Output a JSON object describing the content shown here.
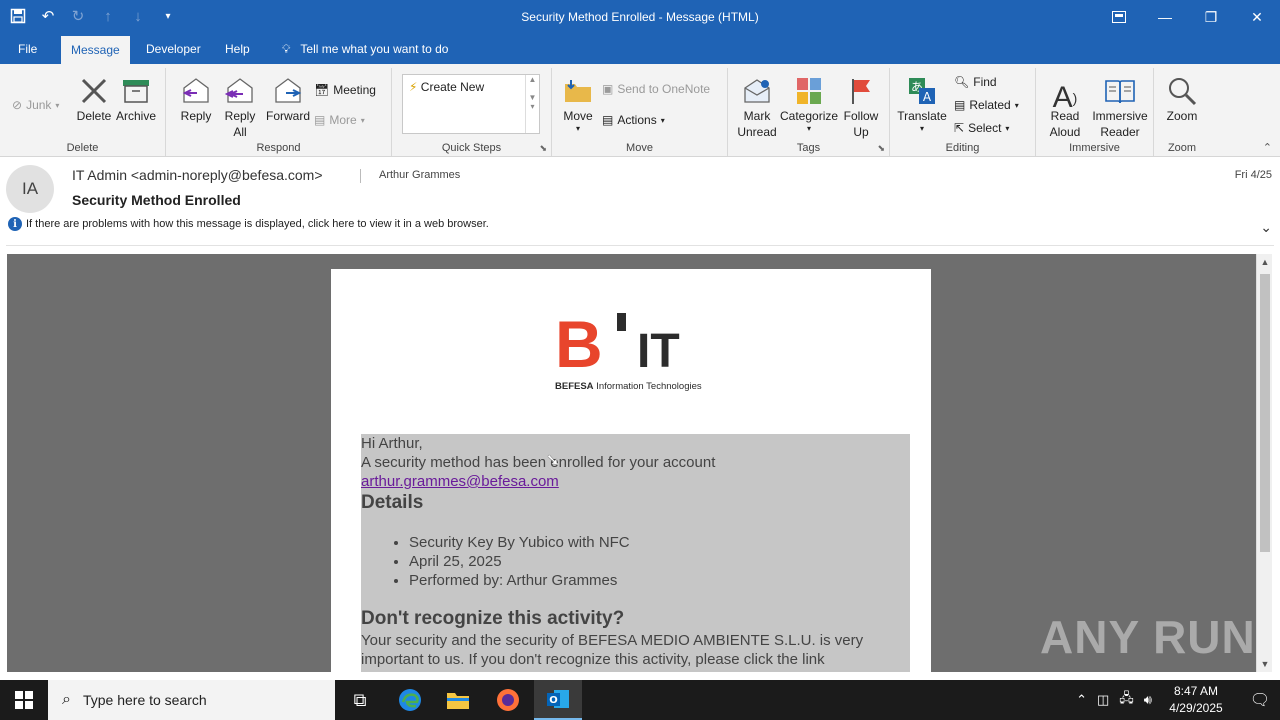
{
  "window": {
    "title": "Security Method Enrolled  -  Message (HTML)"
  },
  "menu": {
    "file": "File",
    "message": "Message",
    "developer": "Developer",
    "help": "Help",
    "tell_me": "Tell me what you want to do"
  },
  "ribbon": {
    "delete_group": {
      "label": "Delete",
      "junk": "Junk",
      "delete": "Delete",
      "archive": "Archive"
    },
    "respond_group": {
      "label": "Respond",
      "reply": "Reply",
      "reply_all_1": "Reply",
      "reply_all_2": "All",
      "forward": "Forward",
      "meeting": "Meeting",
      "more": "More"
    },
    "quicksteps_group": {
      "label": "Quick Steps",
      "create_new": "Create New"
    },
    "move_group": {
      "label": "Move",
      "move": "Move",
      "send_onenote": "Send to OneNote",
      "actions": "Actions"
    },
    "tags_group": {
      "label": "Tags",
      "mark_unread_1": "Mark",
      "mark_unread_2": "Unread",
      "categorize": "Categorize",
      "follow_up_1": "Follow",
      "follow_up_2": "Up"
    },
    "editing_group": {
      "label": "Editing",
      "translate": "Translate",
      "find": "Find",
      "related": "Related",
      "select": "Select"
    },
    "immersive_group": {
      "label": "Immersive",
      "read_aloud_1": "Read",
      "read_aloud_2": "Aloud",
      "immersive_reader_1": "Immersive",
      "immersive_reader_2": "Reader"
    },
    "zoom_group": {
      "label": "Zoom",
      "zoom": "Zoom"
    }
  },
  "message_header": {
    "avatar_initials": "IA",
    "sender": "IT Admin <admin-noreply@befesa.com>",
    "recipient": "Arthur Grammes",
    "date": "Fri 4/25",
    "subject": "Security Method Enrolled",
    "info_bar": "If there are problems with how this message is displayed, click here to view it in a web browser."
  },
  "email_body": {
    "logo_b": "B",
    "logo_it": "IT",
    "logo_company": "BEFESA",
    "logo_tagline": " Information Technologies",
    "greeting": "Hi Arthur,",
    "intro": "A security method has been enrolled for your account",
    "account_link": "arthur.grammes@befesa.com",
    "details_heading": "Details",
    "details": [
      "Security Key By Yubico with NFC",
      "April 25, 2025",
      "Performed by: Arthur Grammes"
    ],
    "question_heading": "Don't recognize this activity?",
    "paragraph": "Your security and the security of BEFESA MEDIO AMBIENTE S.L.U. is very important to us. If you don't recognize this activity, please click the link"
  },
  "watermark": "ANY RUN",
  "taskbar": {
    "search_placeholder": "Type here to search",
    "time": "8:47 AM",
    "date": "4/29/2025"
  },
  "colors": {
    "accent": "#1f63b5",
    "logo_red": "#e8452c",
    "link_purple": "#6a1b9a"
  }
}
